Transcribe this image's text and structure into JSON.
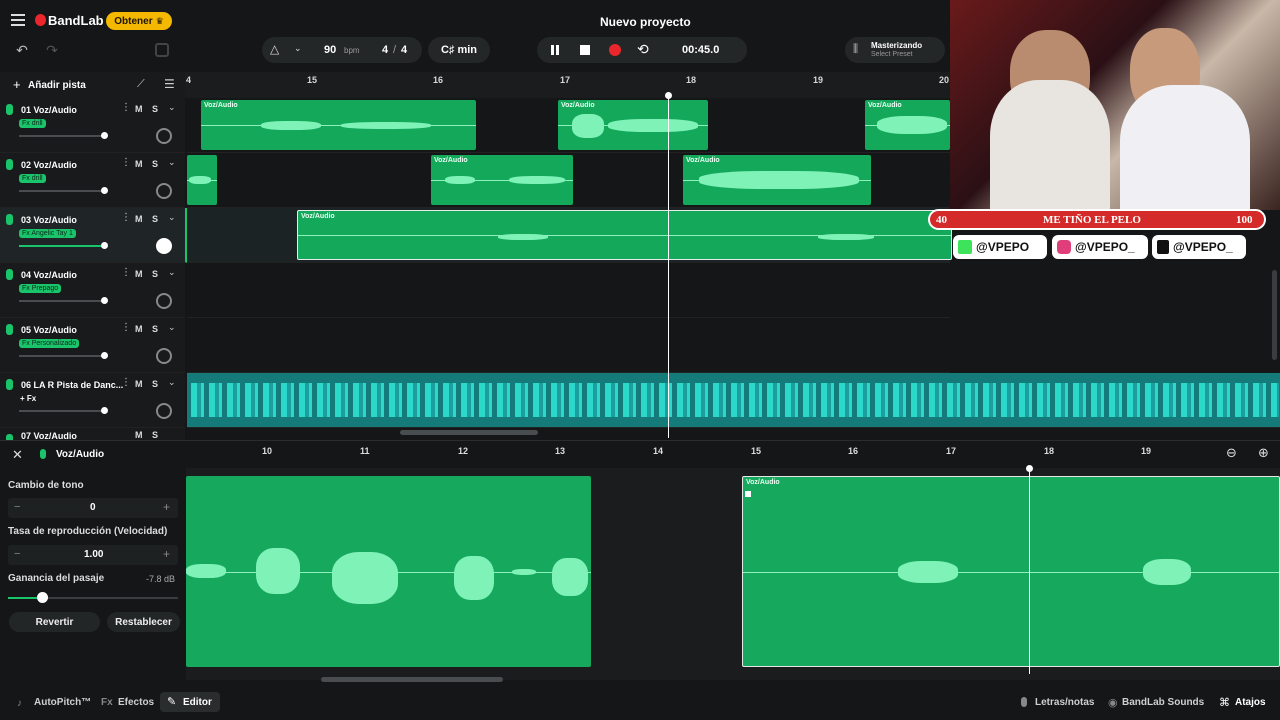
{
  "app": {
    "name": "BandLab",
    "get_label": "Obtener",
    "project_title": "Nuevo proyecto"
  },
  "transport": {
    "bpm": "90",
    "bpm_unit": "bpm",
    "signature_num": "4",
    "signature_den": "4",
    "key": "C♯ min",
    "time": "00:45.0"
  },
  "mastering": {
    "label": "Masterizando",
    "preset": "Select Preset"
  },
  "add_track": "Añadir pista",
  "ruler": [
    "4",
    "15",
    "16",
    "17",
    "18",
    "19",
    "20"
  ],
  "tracks": [
    {
      "name": "01  Voz/Audio",
      "fx": "Fx drill"
    },
    {
      "name": "02  Voz/Audio",
      "fx": "Fx drill"
    },
    {
      "name": "03  Voz/Audio",
      "fx": "Fx Angelic Tay 1"
    },
    {
      "name": "04  Voz/Audio",
      "fx": "Fx Prepago"
    },
    {
      "name": "05  Voz/Audio",
      "fx": "Fx Personalizado"
    },
    {
      "name": "06  LA R Pista de Danc...",
      "fx": "+ Fx"
    },
    {
      "name": "07  Voz/Audio",
      "fx": ""
    }
  ],
  "track_controls": {
    "m": "M",
    "s": "S"
  },
  "clip_label": "Voz/Audio",
  "overlay": {
    "left_num": "40",
    "title": "ME TIÑO EL PELO",
    "right_num": "100",
    "kick": "@VPEPO",
    "instagram": "@VPEPO_",
    "tiktok": "@VPEPO_"
  },
  "editor": {
    "title": "Voz/Audio",
    "pitch_label": "Cambio de tono",
    "pitch_value": "0",
    "rate_label": "Tasa de reproducción (Velocidad)",
    "rate_value": "1.00",
    "gain_label": "Ganancia del pasaje",
    "gain_value": "-7.8 dB",
    "revert": "Revertir",
    "reset": "Restablecer",
    "ruler": [
      "10",
      "11",
      "12",
      "13",
      "14",
      "15",
      "16",
      "17",
      "18",
      "19"
    ]
  },
  "bottom": {
    "autopitch": "AutoPitch™",
    "effects": "Efectos",
    "editor": "Editor",
    "lyrics": "Letras/notas",
    "sounds": "BandLab Sounds",
    "shortcuts": "Atajos"
  },
  "colors": {
    "accent": "#19c46b",
    "record": "#e8262b",
    "get": "#f5b800"
  }
}
